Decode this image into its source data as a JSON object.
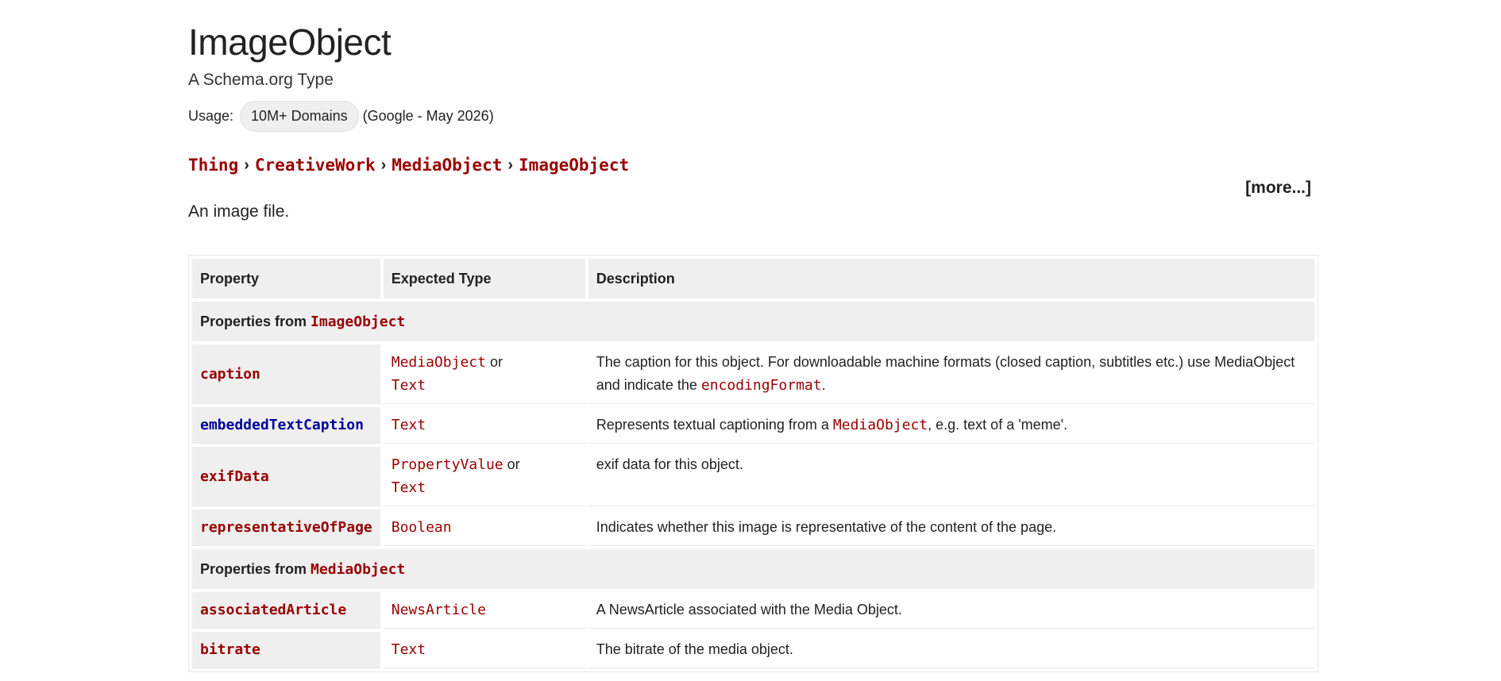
{
  "header": {
    "title": "ImageObject",
    "subtitle": "A Schema.org Type",
    "usage_label": "Usage:",
    "usage_badge": "10M+ Domains",
    "usage_source": "(Google - May 2026)"
  },
  "breadcrumb": [
    "Thing",
    "CreativeWork",
    "MediaObject",
    "ImageObject"
  ],
  "more_link": "[more...]",
  "description": "An image file.",
  "table": {
    "columns": [
      "Property",
      "Expected Type",
      "Description"
    ],
    "sections": [
      {
        "prefix": "Properties from ",
        "type": "ImageObject"
      },
      {
        "prefix": "Properties from ",
        "type": "MediaObject"
      }
    ],
    "rows": [
      {
        "name": "caption",
        "types": [
          "MediaObject",
          "Text"
        ],
        "or": "or",
        "desc_before": "The caption for this object. For downloadable machine formats (closed caption, subtitles etc.) use MediaObject and indicate the ",
        "desc_code": "encodingFormat",
        "desc_after": "."
      },
      {
        "name": "embeddedTextCaption",
        "types": [
          "Text"
        ],
        "desc_before": "Represents textual captioning from a ",
        "desc_code": "MediaObject",
        "desc_after": ", e.g. text of a 'meme'."
      },
      {
        "name": "exifData",
        "types": [
          "PropertyValue",
          "Text"
        ],
        "or": "or",
        "desc": "exif data for this object."
      },
      {
        "name": "representativeOfPage",
        "types": [
          "Boolean"
        ],
        "desc": "Indicates whether this image is representative of the content of the page."
      },
      {
        "name": "associatedArticle",
        "types": [
          "NewsArticle"
        ],
        "desc": "A NewsArticle associated with the Media Object."
      },
      {
        "name": "bitrate",
        "types": [
          "Text"
        ],
        "desc": "The bitrate of the media object."
      }
    ]
  },
  "colors": {
    "link": "#990000",
    "pending_link": "#000099",
    "header_bg": "#efefef"
  }
}
